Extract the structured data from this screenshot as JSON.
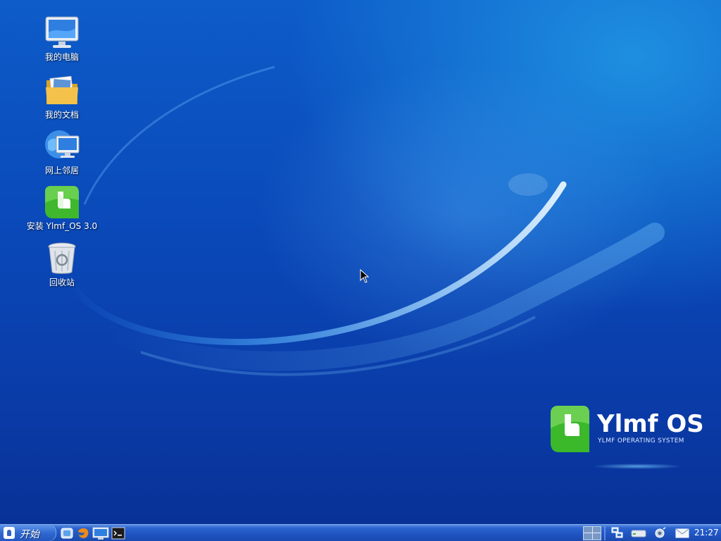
{
  "desktop": {
    "icons": [
      {
        "id": "my-computer",
        "label": "我的电脑",
        "icon": "computer-monitor-icon"
      },
      {
        "id": "my-documents",
        "label": "我的文档",
        "icon": "folder-icon"
      },
      {
        "id": "network",
        "label": "网上邻居",
        "icon": "network-globe-icon"
      },
      {
        "id": "install",
        "label": "安装 Ylmf_OS 3.0",
        "icon": "ylmf-installer-icon"
      },
      {
        "id": "recycle-bin",
        "label": "回收站",
        "icon": "trash-can-icon"
      }
    ],
    "brand": {
      "name": "Ylmf OS",
      "subtitle": "YLMF OPERATING SYSTEM"
    },
    "colors": {
      "background": "#0a48b8",
      "brand_green": "#3cb82b"
    }
  },
  "taskbar": {
    "start_label": "开始",
    "quick_launch": [
      {
        "name": "show-desktop-icon"
      },
      {
        "name": "firefox-icon"
      },
      {
        "name": "file-manager-icon"
      },
      {
        "name": "terminal-icon"
      }
    ],
    "tray": [
      {
        "name": "workspace-switcher-icon"
      },
      {
        "name": "network-status-icon"
      },
      {
        "name": "drive-icon"
      },
      {
        "name": "volume-icon"
      },
      {
        "name": "mail-icon"
      }
    ],
    "clock": "21:27"
  }
}
